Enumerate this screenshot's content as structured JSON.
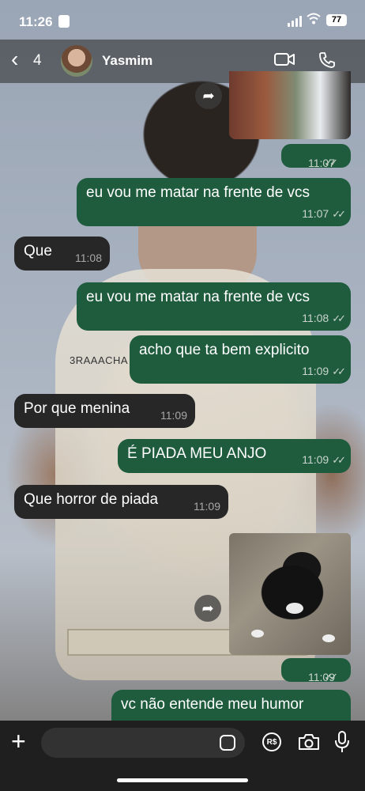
{
  "status_bar": {
    "time": "11:26",
    "battery": "77"
  },
  "header": {
    "back_count": "4",
    "contact_name": "Yasmim"
  },
  "messages": [
    {
      "direction": "out",
      "text": "eu vou me matar na frente de vcs",
      "time": "11:07"
    },
    {
      "direction": "in",
      "text": "Que",
      "time": "11:08"
    },
    {
      "direction": "out",
      "text": "eu vou me matar na frente de vcs",
      "time": "11:08"
    },
    {
      "direction": "out",
      "text": "acho que ta bem explicito",
      "time": "11:09"
    },
    {
      "direction": "in",
      "text": "Por que menina",
      "time": "11:09"
    },
    {
      "direction": "out",
      "text": "É PIADA MEU ANJO",
      "time": "11:09"
    },
    {
      "direction": "in",
      "text": "Que horror de piada",
      "time": "11:09"
    },
    {
      "direction": "out",
      "text": "vc não entende meu humor",
      "time": ""
    }
  ],
  "media": [
    {
      "time": "11:07"
    },
    {
      "time": "11:09"
    }
  ],
  "wallpaper": {
    "shirt_text": "3RAAACHA"
  },
  "composer": {
    "currency_label": "R$"
  },
  "colors": {
    "outgoing": "#1f5c3e",
    "incoming": "#272727",
    "header": "#282828"
  }
}
